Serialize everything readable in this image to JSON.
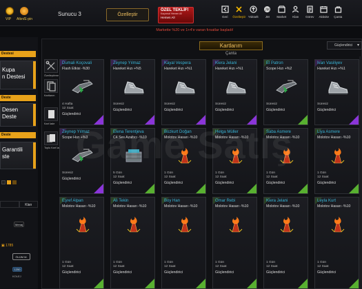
{
  "topbar": {
    "vip_label": "VIP",
    "gold_label": "Altın/E-pin",
    "server": "Sunucu 3",
    "customize_label": "Özelleştir",
    "offer": {
      "title": "ÖZEL TEKLİF!",
      "subtitle": "Kaçırma! Hemen Al!",
      "cta": "Hemen Al!"
    },
    "nav": [
      {
        "label": "Geri",
        "icon": "back-icon"
      },
      {
        "label": "Özelleştir",
        "icon": "tools-icon",
        "active": true
      },
      {
        "label": "Yükselt",
        "icon": "upgrade-icon"
      },
      {
        "label": "JM",
        "icon": "jm-icon"
      },
      {
        "label": "Market",
        "icon": "market-icon"
      },
      {
        "label": "Klan",
        "icon": "clan-icon"
      },
      {
        "label": "Görev",
        "icon": "quest-icon"
      },
      {
        "label": "Aktivite",
        "icon": "calendar-icon"
      },
      {
        "label": "Çanta",
        "icon": "bag-icon"
      }
    ]
  },
  "promo": "Markette %20 ve 1+4'e varan fırsatlar başladı!",
  "left": {
    "header1": "Destesi",
    "card1": [
      "Kupa",
      "n Destesi"
    ],
    "header2": "Deste",
    "card2": [
      "Desen",
      "Deste"
    ],
    "header3": "Deste",
    "card3": [
      "Garantili",
      "ste"
    ],
    "tab_left": "",
    "tab_right": "Klan",
    "label_menaj": "Menaj",
    "gold_value": "1785",
    "badge": "ÖLÜM M.",
    "value2": "1250",
    "value3": "KOLEJ"
  },
  "main": {
    "title": "Kartlarım",
    "subtitle": "Çanta",
    "sort_select": "Güçlendirici",
    "tools": [
      {
        "label": "Özelleştirme",
        "icon": "wrench-icon"
      },
      {
        "label": "Kartlarım",
        "icon": "cards-icon"
      },
      {
        "label": "Kart İade",
        "icon": "card-return-icon"
      },
      {
        "label": "Toplu Kart İade",
        "icon": "bulk-return-icon"
      }
    ],
    "cards": [
      {
        "name": "Dumali Koçovali",
        "effect": "Flash Etkisi -%30",
        "duration": "4 Hafta 12 Saat",
        "type": "Güçlendirici",
        "rarity": "purple",
        "art": "rifle"
      },
      {
        "name": "Zeynep Yılmaz",
        "effect": "Hareket Hızı +%5",
        "duration": "Süresiz",
        "type": "Güçlendirici",
        "rarity": "purple",
        "art": "shoe"
      },
      {
        "name": "Kayal Vespera",
        "effect": "Hareket Hızı +%1",
        "duration": "Süresiz",
        "type": "Güçlendirici",
        "rarity": "purple",
        "art": "shoe"
      },
      {
        "name": "Kiera Jelani",
        "effect": "Hareket Hızı +%1",
        "duration": "Süresiz",
        "type": "Güçlendirici",
        "rarity": "purple",
        "art": "shoe"
      },
      {
        "name": "El Patron",
        "effect": "Scope Hızı +%2",
        "duration": "Süresiz",
        "type": "Güçlendirici",
        "rarity": "green",
        "art": "rifle"
      },
      {
        "name": "Ivan Vasiliyev",
        "effect": "Hareket Hızı +%1",
        "duration": "Süresiz",
        "type": "Güçlendirici",
        "rarity": "purple",
        "art": "shoe"
      },
      {
        "name": "Zeynep Yılmaz",
        "effect": "Scope Hızı +%3",
        "duration": "Süresiz",
        "type": "Güçlendirici",
        "rarity": "purple",
        "art": "rifle"
      },
      {
        "name": "Elena Terentjeva",
        "effect": "C4 Ses Azaltıcı -%10",
        "duration": "5 Gün 12 Saat",
        "type": "Güçlendirici",
        "rarity": "green",
        "art": "c4"
      },
      {
        "name": "Bozkurt Doğan",
        "effect": "Molotov Hasarı -%10",
        "duration": "1 Gün 12 Saat",
        "type": "Güçlendirici",
        "rarity": "green",
        "art": "molotov"
      },
      {
        "name": "Helga Müller",
        "effect": "Molotov Hasarı -%10",
        "duration": "1 Gün 12 Saat",
        "type": "Güçlendirici",
        "rarity": "green",
        "art": "molotov"
      },
      {
        "name": "Saba Asmere",
        "effect": "Molotov Hasarı -%10",
        "duration": "1 Gün 12 Saat",
        "type": "Güçlendirici",
        "rarity": "green",
        "art": "molotov"
      },
      {
        "name": "Liya Asmere",
        "effect": "Molotov Hasarı -%10",
        "duration": "1 Gün 12 Saat",
        "type": "Güçlendirici",
        "rarity": "green",
        "art": "molotov"
      },
      {
        "name": "Eşref Alpan",
        "effect": "Molotov Hasarı -%10",
        "duration": "1 Gün 12 Saat",
        "type": "Güçlendirici",
        "rarity": "green",
        "art": "molotov"
      },
      {
        "name": "Ali Tekin",
        "effect": "Molotov Hasarı -%10",
        "duration": "1 Gün 12 Saat",
        "type": "Güçlendirici",
        "rarity": "green",
        "art": "molotov"
      },
      {
        "name": "Boy Han",
        "effect": "Molotov Hasarı -%10",
        "duration": "1 Gün 12 Saat",
        "type": "Güçlendirici",
        "rarity": "green",
        "art": "molotov"
      },
      {
        "name": "Omar Rebi",
        "effect": "Molotov Hasarı -%10",
        "duration": "1 Gün 12 Saat",
        "type": "Güçlendirici",
        "rarity": "green",
        "art": "molotov"
      },
      {
        "name": "Kiera Jelani",
        "effect": "Molotov Hasarı -%10",
        "duration": "1 Gün 12 Saat",
        "type": "Güçlendirici",
        "rarity": "green",
        "art": "molotov"
      },
      {
        "name": "Leyla Kurt",
        "effect": "Molotov Hasarı -%10",
        "duration": "1 Gün 12 Saat",
        "type": "Güçlendirici",
        "rarity": "green",
        "art": "molotov"
      }
    ]
  },
  "watermark": "Game Satış",
  "colors": {
    "accent": "#e8a21a",
    "name_blue": "#39b6d8",
    "purple": "#8a35d8",
    "green": "#58b030",
    "promo_red": "#e04a3a"
  }
}
